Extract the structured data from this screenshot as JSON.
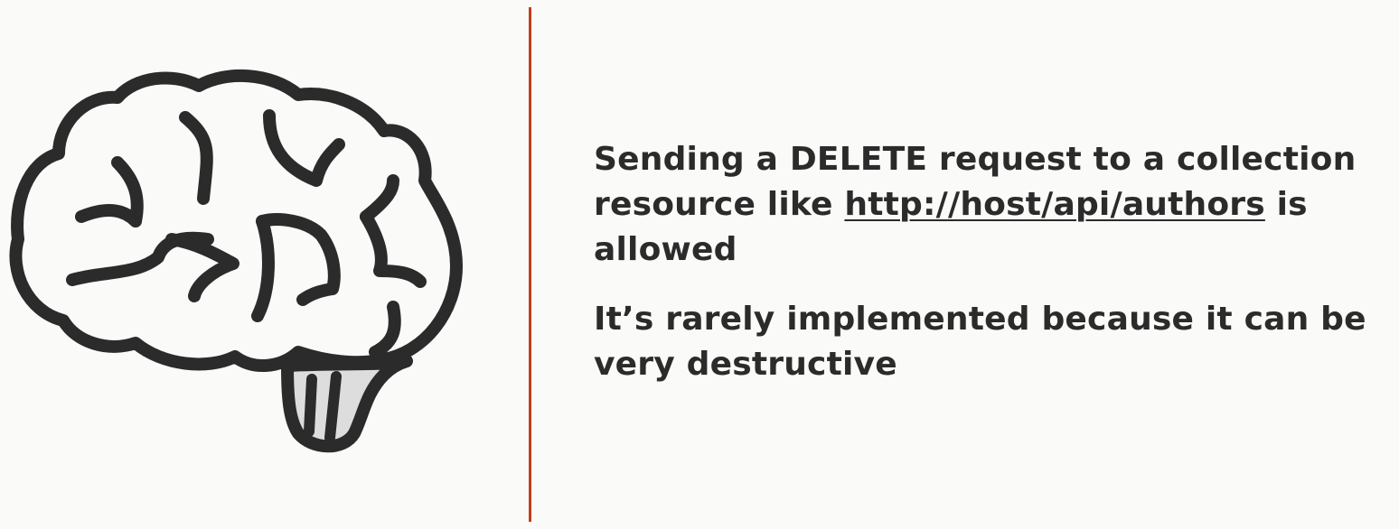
{
  "colors": {
    "background": "#fafaf8",
    "divider": "#c0401c",
    "text": "#2b2b2b",
    "icon_stroke": "#2b2b2b",
    "brainstem_fill": "#dddddd"
  },
  "illustration": {
    "icon": "brain-icon"
  },
  "content": {
    "point1": {
      "before": "Sending a DELETE request to a collection resource like ",
      "link": "http://host/api/authors",
      "after": " is allowed"
    },
    "point2": "It’s rarely implemented because it can be very destructive"
  }
}
